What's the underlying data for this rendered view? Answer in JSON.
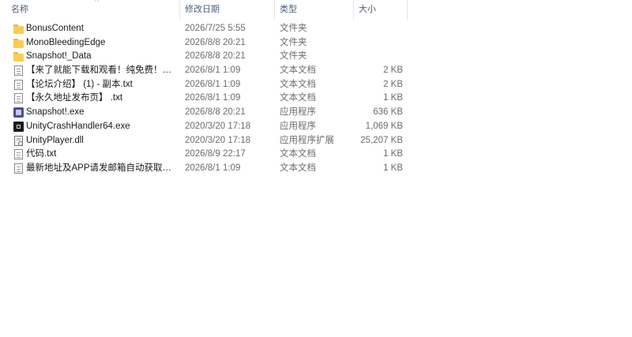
{
  "columns": {
    "name": "名称",
    "date": "修改日期",
    "type": "类型",
    "size": "大小"
  },
  "sort_indicator": "^",
  "files": [
    {
      "name": "BonusContent",
      "date": "2026/7/25 5:55",
      "type": "文件夹",
      "size": "",
      "icon": "folder-icon"
    },
    {
      "name": "MonoBleedingEdge",
      "date": "2026/8/8 20:21",
      "type": "文件夹",
      "size": "",
      "icon": "folder-icon"
    },
    {
      "name": "Snapshot!_Data",
      "date": "2026/8/8 20:21",
      "type": "文件夹",
      "size": "",
      "icon": "folder-icon"
    },
    {
      "name": "【来了就能下载和观看！纯免费！】 - 副...",
      "date": "2026/8/1 1:09",
      "type": "文本文档",
      "size": "2 KB",
      "icon": "text-file-icon"
    },
    {
      "name": "【论坛介绍】 (1) - 副本.txt",
      "date": "2026/8/1 1:09",
      "type": "文本文档",
      "size": "2 KB",
      "icon": "text-file-icon"
    },
    {
      "name": "【永久地址发布页】 .txt",
      "date": "2026/8/1 1:09",
      "type": "文本文档",
      "size": "1 KB",
      "icon": "text-file-icon"
    },
    {
      "name": "Snapshot!.exe",
      "date": "2026/8/8 20:21",
      "type": "应用程序",
      "size": "636 KB",
      "icon": "exe-icon"
    },
    {
      "name": "UnityCrashHandler64.exe",
      "date": "2020/3/20 17:18",
      "type": "应用程序",
      "size": "1,069 KB",
      "icon": "crash-handler-icon"
    },
    {
      "name": "UnityPlayer.dll",
      "date": "2020/3/20 17:18",
      "type": "应用程序扩展",
      "size": "25,207 KB",
      "icon": "dll-icon"
    },
    {
      "name": "代码.txt",
      "date": "2026/8/9 22:17",
      "type": "文本文档",
      "size": "1 KB",
      "icon": "text-file-icon"
    },
    {
      "name": "最新地址及APP请发邮箱自动获取！！！...",
      "date": "2026/8/1 1:09",
      "type": "文本文档",
      "size": "1 KB",
      "icon": "text-file-icon"
    }
  ]
}
